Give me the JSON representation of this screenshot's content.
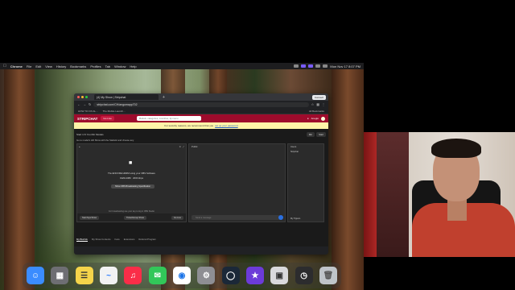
{
  "menubar": {
    "app_name": "Chrome",
    "items": [
      "File",
      "Edit",
      "View",
      "History",
      "Bookmarks",
      "Profiles",
      "Tab",
      "Window",
      "Help"
    ],
    "clock": "Mon Nov 17 8:07 PM"
  },
  "browser": {
    "tab_title": "(4) My Show | Stripchat",
    "connect_label": "Connect",
    "url": "stripchat.com/CH/angumapp702",
    "bookmarks": [
      "HOW TO FIX AL...",
      "The Mobile Launch..."
    ],
    "bookmarks_right": "All Bookmarks"
  },
  "site": {
    "logo": "STRIPCHAT",
    "live_label": "Go Live",
    "search_placeholder": "Models, categories, countries, tip menu",
    "user_label": "Anuglo"
  },
  "warning": {
    "text": "For security reasons, we recommend that you",
    "link": "set up your password"
  },
  "show": {
    "title": "Start 1:N You Mic Models",
    "subtitle": "Go to model's HD Show with the Statistic and choose any",
    "buttons": [
      "Mic",
      "Start"
    ]
  },
  "video": {
    "camera_status": "The ENCORE HDRM using your OBS Software",
    "resolution": "1920x1080",
    "bitrate": "2000 kbps",
    "settings_button": "Show OBS Broadcasting Specification",
    "footer": "For broadcasting use your key to log in OBS Studio",
    "bottom_left": "Start Nya Show",
    "bottom_center": "Ticket/Group Show",
    "bottom_right": "Go Live"
  },
  "chat": {
    "header": "Public",
    "input_placeholder": "Send a message"
  },
  "users": {
    "header": "Users",
    "list": [
      "Stripchat"
    ],
    "footer": "My Tippers"
  },
  "tabs": [
    "My Bio/Info",
    "My Show Contents",
    "Fans",
    "Extensions",
    "Referral Program"
  ],
  "dock": {
    "apps": [
      "Finder",
      "Launchpad",
      "Notes",
      "Freeform",
      "Music",
      "Messages",
      "Chrome",
      "Settings",
      "Steam",
      "iMovie",
      "Preview",
      "Activity",
      "Trash"
    ]
  }
}
